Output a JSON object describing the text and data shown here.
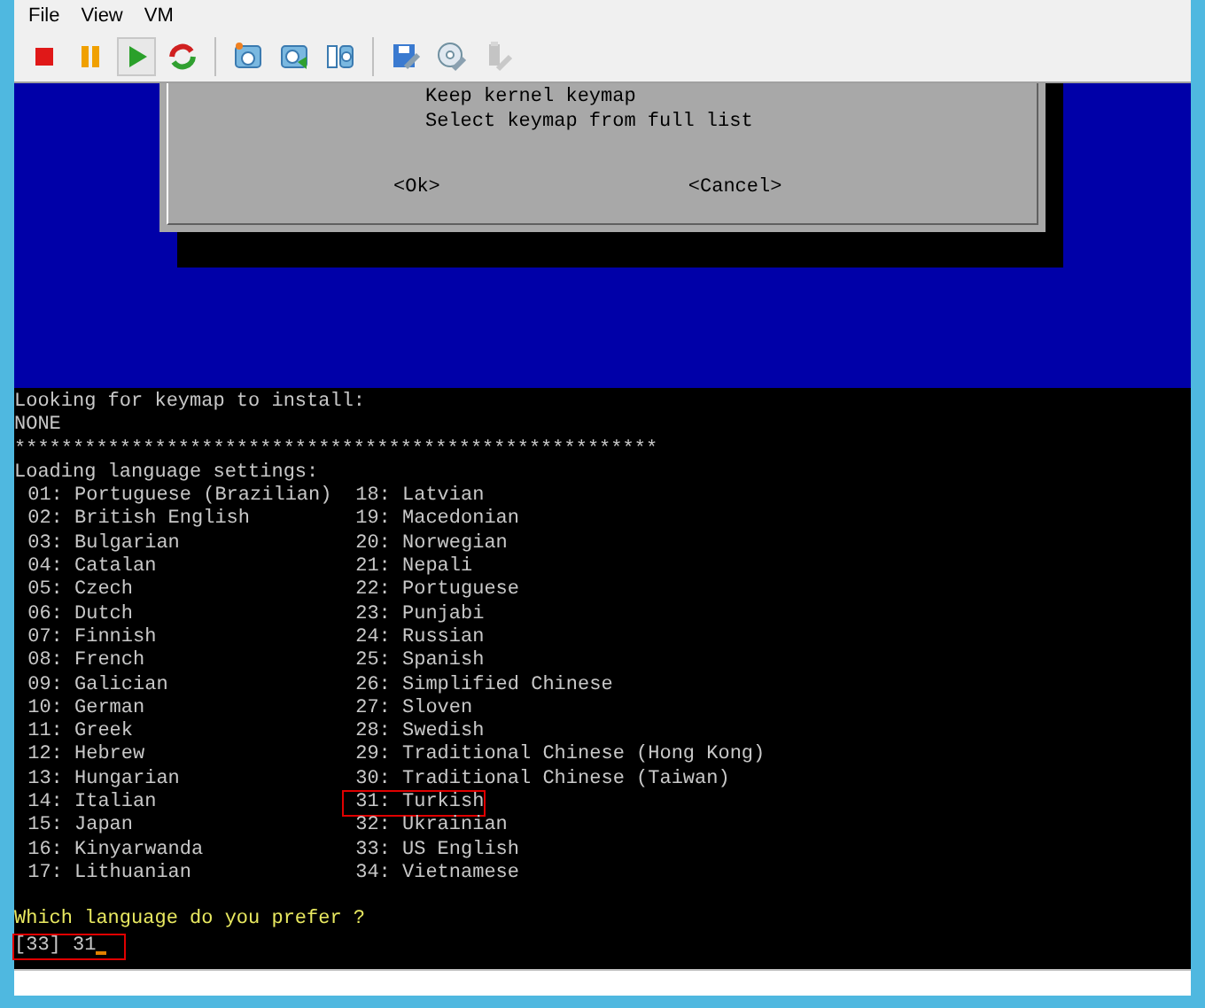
{
  "menu": [
    "File",
    "View",
    "VM"
  ],
  "toolbar": [
    {
      "kind": "stop",
      "selected": false,
      "disabled": false
    },
    {
      "kind": "pause",
      "selected": false,
      "disabled": false
    },
    {
      "kind": "play",
      "selected": true,
      "disabled": false
    },
    {
      "kind": "reset",
      "selected": false,
      "disabled": false
    },
    {
      "kind": "separator"
    },
    {
      "kind": "snapshot",
      "selected": false,
      "disabled": false
    },
    {
      "kind": "revert",
      "selected": false,
      "disabled": false
    },
    {
      "kind": "manager",
      "selected": false,
      "disabled": false
    },
    {
      "kind": "separator"
    },
    {
      "kind": "settings",
      "selected": false,
      "disabled": false
    },
    {
      "kind": "media",
      "selected": false,
      "disabled": false
    },
    {
      "kind": "usb",
      "selected": false,
      "disabled": true
    }
  ],
  "dialog": {
    "options": [
      "Keep kernel keymap",
      "Select keymap from full list"
    ],
    "buttons": [
      "<Ok>",
      "<Cancel>"
    ]
  },
  "terminal": {
    "header": [
      "Looking for keymap to install:",
      "NONE",
      "*******************************************************",
      "Loading language settings:"
    ],
    "languages_left": [
      {
        "label": "01: Portuguese (Brazilian)",
        "highlighted": false
      },
      {
        "label": "02: British English",
        "highlighted": false
      },
      {
        "label": "03: Bulgarian",
        "highlighted": false
      },
      {
        "label": "04: Catalan",
        "highlighted": false
      },
      {
        "label": "05: Czech",
        "highlighted": false
      },
      {
        "label": "06: Dutch",
        "highlighted": false
      },
      {
        "label": "07: Finnish",
        "highlighted": false
      },
      {
        "label": "08: French",
        "highlighted": false
      },
      {
        "label": "09: Galician",
        "highlighted": false
      },
      {
        "label": "10: German",
        "highlighted": false
      },
      {
        "label": "11: Greek",
        "highlighted": false
      },
      {
        "label": "12: Hebrew",
        "highlighted": false
      },
      {
        "label": "13: Hungarian",
        "highlighted": false
      },
      {
        "label": "14: Italian",
        "highlighted": false
      },
      {
        "label": "15: Japan",
        "highlighted": false
      },
      {
        "label": "16: Kinyarwanda",
        "highlighted": false
      },
      {
        "label": "17: Lithuanian",
        "highlighted": false
      }
    ],
    "languages_right": [
      {
        "label": "18: Latvian",
        "highlighted": false
      },
      {
        "label": "19: Macedonian",
        "highlighted": false
      },
      {
        "label": "20: Norwegian",
        "highlighted": false
      },
      {
        "label": "21: Nepali",
        "highlighted": false
      },
      {
        "label": "22: Portuguese",
        "highlighted": false
      },
      {
        "label": "23: Punjabi",
        "highlighted": false
      },
      {
        "label": "24: Russian",
        "highlighted": false
      },
      {
        "label": "25: Spanish",
        "highlighted": false
      },
      {
        "label": "26: Simplified Chinese",
        "highlighted": false
      },
      {
        "label": "27: Sloven",
        "highlighted": false
      },
      {
        "label": "28: Swedish",
        "highlighted": false
      },
      {
        "label": "29: Traditional Chinese (Hong Kong)",
        "highlighted": false
      },
      {
        "label": "30: Traditional Chinese (Taiwan)",
        "highlighted": false
      },
      {
        "label": "31: Turkish",
        "highlighted": true
      },
      {
        "label": "32: Ukrainian",
        "highlighted": false
      },
      {
        "label": "33: US English",
        "highlighted": false
      },
      {
        "label": "34: Vietnamese",
        "highlighted": false
      }
    ],
    "prompt": "Which language do you prefer ?",
    "input": {
      "value": "[33] 31",
      "highlighted": true
    }
  }
}
